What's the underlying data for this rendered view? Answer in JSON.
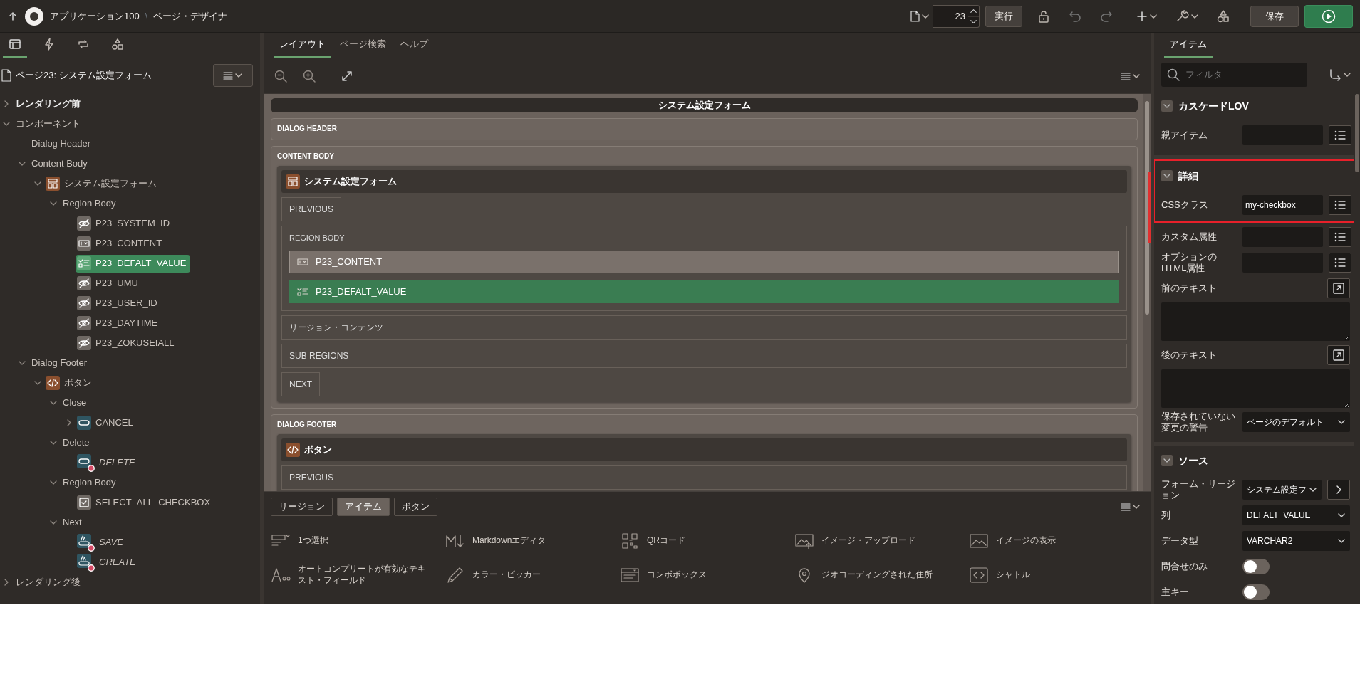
{
  "topbar": {
    "app_name": "アプリケーション100",
    "separator": "\\",
    "title": "ページ・デザイナ",
    "page_number": "23",
    "run_label": "実行",
    "save_label": "保存"
  },
  "left": {
    "tabs": [
      {
        "selected": true
      },
      {
        "selected": false
      },
      {
        "selected": false
      },
      {
        "selected": false
      }
    ],
    "page_title": "ページ23: システム設定フォーム",
    "tree": [
      {
        "label": "レンダリング前",
        "bold": true,
        "expanded": false,
        "selected": false
      },
      {
        "label": "コンポーネント",
        "bold": false,
        "expanded": true,
        "selected": false,
        "children": [
          {
            "label": "Dialog Header",
            "selected": false
          },
          {
            "label": "Content Body",
            "expanded": true,
            "selected": false,
            "children": [
              {
                "label": "システム設定フォーム",
                "kind": "region",
                "expanded": true,
                "selected": false,
                "children": [
                  {
                    "label": "Region Body",
                    "expanded": true,
                    "selected": false,
                    "children": [
                      {
                        "label": "P23_SYSTEM_ID",
                        "kind": "hidden",
                        "selected": false
                      },
                      {
                        "label": "P23_CONTENT",
                        "kind": "textarea",
                        "selected": false
                      },
                      {
                        "label": "P23_DEFALT_VALUE",
                        "kind": "checkbox_group",
                        "selected": true
                      },
                      {
                        "label": "P23_UMU",
                        "kind": "hidden",
                        "selected": false
                      },
                      {
                        "label": "P23_USER_ID",
                        "kind": "hidden",
                        "selected": false
                      },
                      {
                        "label": "P23_DAYTIME",
                        "kind": "hidden",
                        "selected": false
                      },
                      {
                        "label": "P23_ZOKUSEIALL",
                        "kind": "hidden",
                        "selected": false
                      }
                    ]
                  }
                ]
              }
            ]
          },
          {
            "label": "Dialog Footer",
            "expanded": true,
            "selected": false,
            "children": [
              {
                "label": "ボタン",
                "kind": "code",
                "expanded": true,
                "selected": false,
                "children": [
                  {
                    "label": "Close",
                    "expanded": true,
                    "selected": false,
                    "children": [
                      {
                        "label": "CANCEL",
                        "kind": "button",
                        "expanded": false,
                        "flagged": false,
                        "selected": false
                      }
                    ]
                  },
                  {
                    "label": "Delete",
                    "expanded": true,
                    "selected": false,
                    "children": [
                      {
                        "label": "DELETE",
                        "kind": "button",
                        "flagged": true,
                        "selected": false
                      }
                    ]
                  },
                  {
                    "label": "Region Body",
                    "expanded": true,
                    "selected": false,
                    "children": [
                      {
                        "label": "SELECT_ALL_CHECKBOX",
                        "kind": "checkbox",
                        "selected": false
                      }
                    ]
                  },
                  {
                    "label": "Next",
                    "expanded": true,
                    "selected": false,
                    "children": [
                      {
                        "label": "SAVE",
                        "kind": "save",
                        "flagged": true,
                        "selected": false
                      },
                      {
                        "label": "CREATE",
                        "kind": "save",
                        "flagged": true,
                        "selected": false
                      }
                    ]
                  }
                ]
              }
            ]
          }
        ]
      },
      {
        "label": "レンダリング後",
        "bold": false,
        "expanded": false,
        "selected": false
      }
    ]
  },
  "center": {
    "tabs": [
      {
        "label": "レイアウト",
        "selected": true
      },
      {
        "label": "ページ検索",
        "selected": false
      },
      {
        "label": "ヘルプ",
        "selected": false
      }
    ],
    "canvas": {
      "title": "システム設定フォーム",
      "sections": [
        {
          "label": "DIALOG HEADER"
        },
        {
          "label": "CONTENT BODY",
          "region": {
            "title": "システム設定フォーム",
            "kind": "region",
            "slots": [
              {
                "kind": "slot",
                "label": "PREVIOUS"
              },
              {
                "kind": "body",
                "label": "REGION BODY",
                "items": [
                  {
                    "label": "P23_CONTENT",
                    "kind": "textarea",
                    "selected": false
                  },
                  {
                    "label": "P23_DEFALT_VALUE",
                    "kind": "checkbox_group",
                    "selected": true
                  }
                ]
              },
              {
                "kind": "wide",
                "label": "リージョン・コンテンツ"
              },
              {
                "kind": "wide",
                "label": "SUB REGIONS"
              },
              {
                "kind": "slot",
                "label": "NEXT"
              }
            ]
          }
        },
        {
          "label": "DIALOG FOOTER",
          "region": {
            "title": "ボタン",
            "kind": "code",
            "slots": [
              {
                "kind": "wide",
                "label": "PREVIOUS"
              }
            ]
          }
        }
      ]
    },
    "gallery": {
      "tabs": [
        {
          "label": "リージョン",
          "selected": false
        },
        {
          "label": "アイテム",
          "selected": true
        },
        {
          "label": "ボタン",
          "selected": false
        }
      ],
      "items": [
        {
          "label": "1つ選択"
        },
        {
          "label": "Markdownエディタ"
        },
        {
          "label": "QRコード"
        },
        {
          "label": "イメージ・アップロード"
        },
        {
          "label": "イメージの表示"
        },
        {
          "label": "オートコンプリートが有効なテキスト・フィールド"
        },
        {
          "label": "カラー・ピッカー"
        },
        {
          "label": "コンボボックス"
        },
        {
          "label": "ジオコーディングされた住所"
        },
        {
          "label": "シャトル"
        }
      ]
    }
  },
  "right": {
    "tabs": [
      {
        "label": "アイテム",
        "selected": true
      }
    ],
    "filter_placeholder": "フィルタ",
    "groups": [
      {
        "title": "カスケードLOV",
        "expanded": true,
        "highlighted": false,
        "fields": [
          {
            "label": "親アイテム",
            "kind": "text",
            "list_button": true
          }
        ]
      },
      {
        "title": "詳細",
        "expanded": true,
        "highlighted": true,
        "fields": [
          {
            "label": "CSSクラス",
            "kind": "text",
            "value": "my-checkbox",
            "list_button": true,
            "highlighted": true
          },
          {
            "label": "カスタム属性",
            "kind": "text",
            "list_button": true,
            "highlighted": false
          },
          {
            "label": "オプションのHTML属性",
            "kind": "text",
            "list_button": true,
            "highlighted": false
          },
          {
            "label": "前のテキスト",
            "kind": "textarea",
            "expand_button": true,
            "highlighted": false
          },
          {
            "label": "後のテキスト",
            "kind": "textarea",
            "expand_button": true,
            "highlighted": false
          },
          {
            "label": "保存されていない変更の警告",
            "kind": "select",
            "value": "ページのデフォルト",
            "highlighted": false
          }
        ]
      },
      {
        "title": "ソース",
        "expanded": true,
        "highlighted": false,
        "fields": [
          {
            "label": "フォーム・リージョン",
            "kind": "select",
            "value": "システム設定フ",
            "go_button": true
          },
          {
            "label": "列",
            "kind": "select",
            "value": "DEFALT_VALUE"
          },
          {
            "label": "データ型",
            "kind": "select",
            "value": "VARCHAR2"
          },
          {
            "label": "問合せのみ",
            "kind": "switch",
            "on": false
          },
          {
            "label": "主キー",
            "kind": "switch",
            "on": false
          }
        ]
      }
    ]
  }
}
